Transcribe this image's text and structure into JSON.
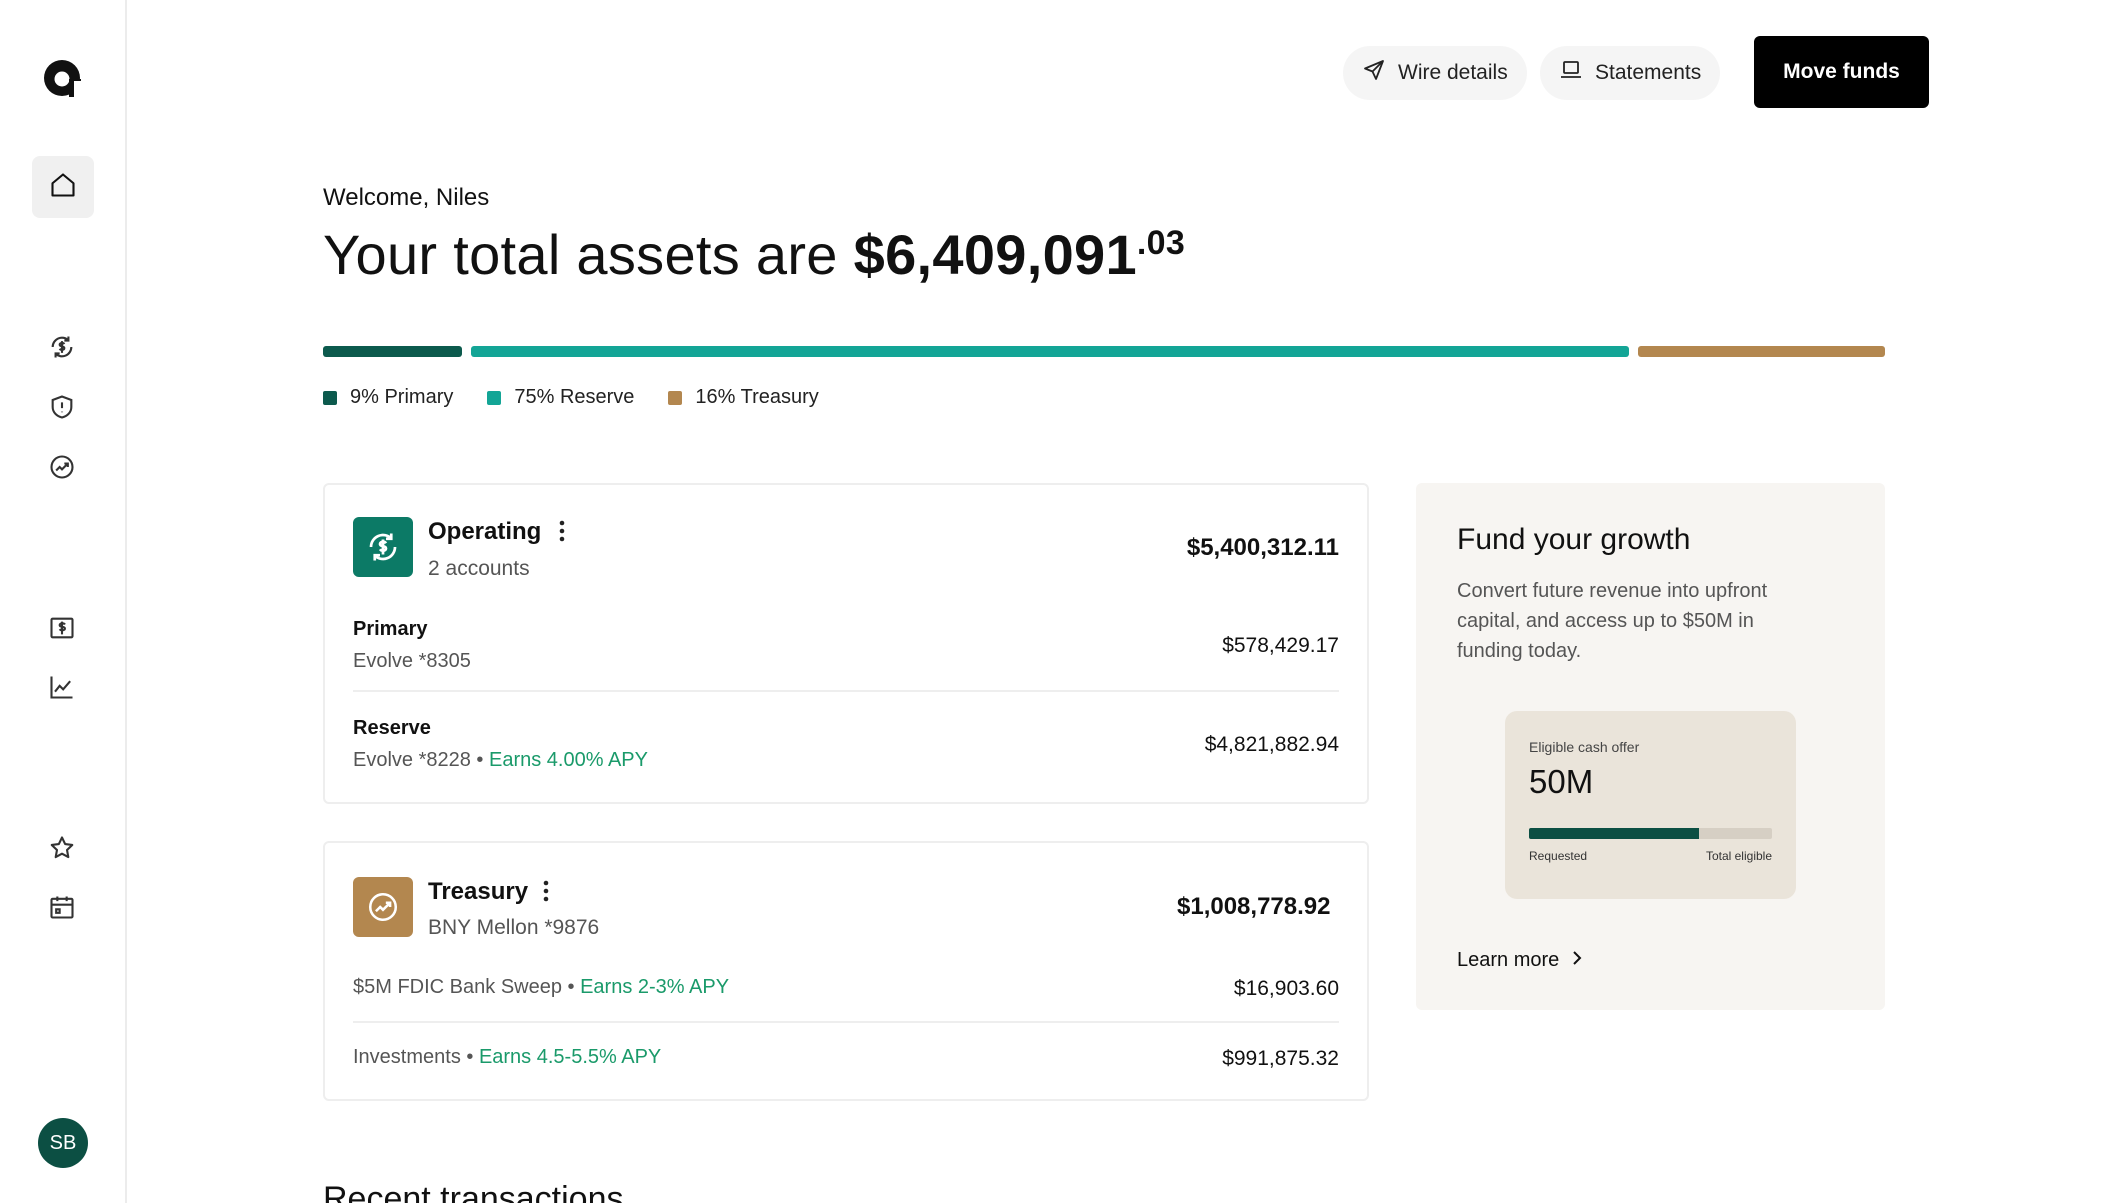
{
  "user": {
    "initials": "SB"
  },
  "header": {
    "wire_label": "Wire details",
    "statements_label": "Statements",
    "move_funds_label": "Move funds"
  },
  "welcome": "Welcome, Niles",
  "total": {
    "prefix": "Your total assets are ",
    "amount": "$6,409,091",
    "cents": ".03"
  },
  "allocation": [
    {
      "label": "9% Primary",
      "percent": 9,
      "color": "#0c5a4d"
    },
    {
      "label": "75% Reserve",
      "percent": 75,
      "color": "#13a596"
    },
    {
      "label": "16% Treasury",
      "percent": 16,
      "color": "#b3874f"
    }
  ],
  "operating": {
    "title": "Operating",
    "subtitle": "2 accounts",
    "total": "$5,400,312.11",
    "icon_color": "#0c7a66",
    "rows": [
      {
        "title": "Primary",
        "sub": "Evolve *8305",
        "earn": "",
        "amount": "$578,429.17"
      },
      {
        "title": "Reserve",
        "sub": "Evolve *8228 • ",
        "earn": "Earns 4.00% APY",
        "amount": "$4,821,882.94"
      }
    ]
  },
  "treasury": {
    "title": "Treasury",
    "subtitle": "BNY Mellon *9876",
    "total": "$1,008,778.92",
    "icon_color": "#b3874f",
    "rows": [
      {
        "sub": "$5M FDIC Bank Sweep • ",
        "earn": "Earns 2-3% APY",
        "amount": "$16,903.60"
      },
      {
        "sub": "Investments • ",
        "earn": "Earns 4.5-5.5% APY",
        "amount": "$991,875.32"
      }
    ]
  },
  "growth": {
    "title": "Fund your growth",
    "description": "Convert future revenue into upfront capital, and access up to $50M in funding today.",
    "offer_label": "Eligible cash offer",
    "offer_value": "50M",
    "requested_fraction": 0.7,
    "requested_label": "Requested",
    "total_label": "Total eligible",
    "learn_more": "Learn more"
  },
  "recent_title": "Recent transactions"
}
